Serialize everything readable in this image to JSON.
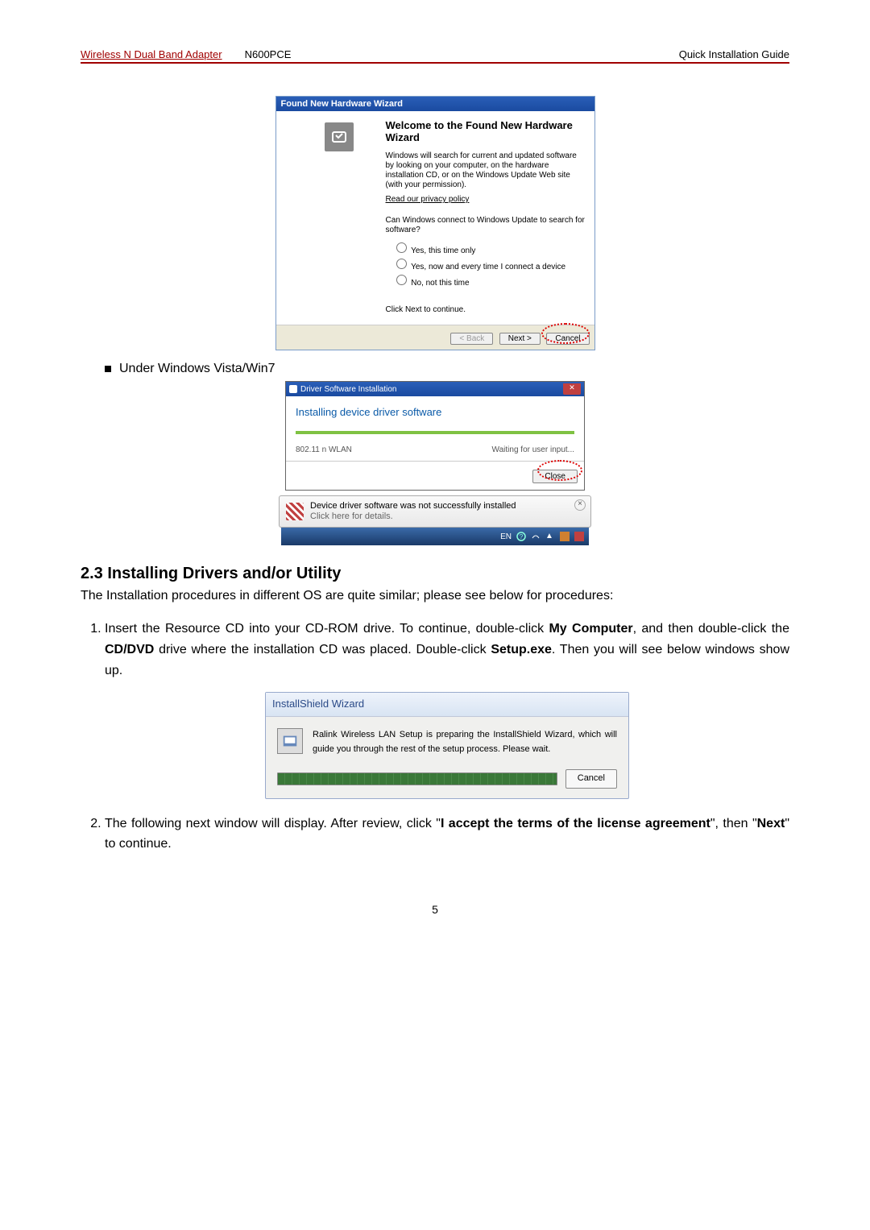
{
  "header": {
    "product": "Wireless N Dual Band Adapter",
    "model": "N600PCE",
    "guide": "Quick Installation Guide"
  },
  "xp_wizard": {
    "title": "Found New Hardware Wizard",
    "heading": "Welcome to the Found New Hardware Wizard",
    "desc": "Windows will search for current and updated software by looking on your computer, on the hardware installation CD, or on the Windows Update Web site (with your permission).",
    "privacy_link": "Read our privacy policy",
    "question": "Can Windows connect to Windows Update to search for software?",
    "opt1": "Yes, this time only",
    "opt2": "Yes, now and every time I connect a device",
    "opt3": "No, not this time",
    "continue_hint": "Click Next to continue.",
    "btn_back": "< Back",
    "btn_next": "Next >",
    "btn_cancel": "Cancel"
  },
  "bullet_vista": "Under Windows Vista/Win7",
  "vista": {
    "title": "Driver Software Installation",
    "heading": "Installing device driver software",
    "device": "802.11 n WLAN",
    "status": "Waiting for user input...",
    "btn_close": "Close"
  },
  "toast": {
    "line1": "Device driver software was not successfully installed",
    "line2": "Click here for details."
  },
  "taskbar": {
    "lang": "EN"
  },
  "section23": {
    "title": "2.3 Installing Drivers and/or Utility",
    "intro": "The Installation procedures in different OS are quite similar; please see below for procedures:",
    "step1_a": "Insert the Resource CD into your CD-ROM drive. To continue, double-click ",
    "step1_b": "My Computer",
    "step1_c": ", and then double-click the ",
    "step1_d": "CD/DVD",
    "step1_e": " drive where the installation CD was placed. Double-click ",
    "step1_f": "Setup.exe",
    "step1_g": ". Then you will see below windows show up.",
    "step2_a": "The following next window will display. After review, click \"",
    "step2_b": "I accept the terms of the license agreement",
    "step2_c": "\", then \"",
    "step2_d": "Next",
    "step2_e": "\" to continue."
  },
  "installshield": {
    "title": "InstallShield Wizard",
    "body": "Ralink Wireless LAN Setup is preparing the InstallShield Wizard, which will guide you through the rest of the setup process. Please wait.",
    "btn_cancel": "Cancel"
  },
  "page_number": "5"
}
